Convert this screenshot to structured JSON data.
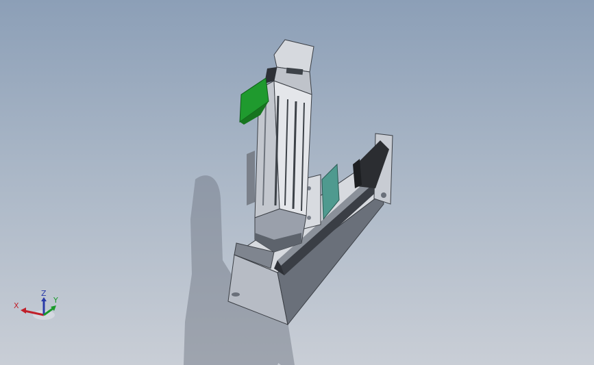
{
  "viewport": {
    "background_top": "#8c9fb7",
    "background_bottom": "#c9ced6"
  },
  "model": {
    "description_icon": "linear-actuator-assembly-icon",
    "colors": {
      "body_light": "#e4e6ea",
      "body_mid": "#b9bec6",
      "body_dark": "#5d636c",
      "base_plate": "#9aa0ab",
      "motor": "#2b2d31",
      "green_bracket": "#1f9a2e",
      "teal_plate": "#4f9a8f",
      "shadow": "#6c7380"
    }
  },
  "triad": {
    "x_label": "X",
    "y_label": "Y",
    "z_label": "Z",
    "x_color": "#c0202a",
    "y_color": "#1a9a2a",
    "z_color": "#2a3aa8"
  }
}
